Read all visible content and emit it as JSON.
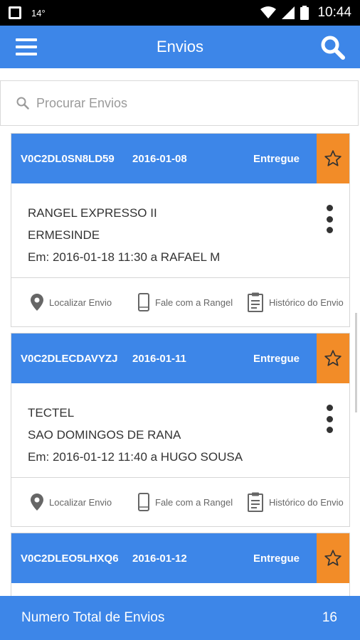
{
  "status_bar": {
    "temperature": "14°",
    "time": "10:44"
  },
  "app_bar": {
    "title": "Envios"
  },
  "search": {
    "placeholder": "Procurar Envios"
  },
  "shipments": [
    {
      "code": "V0C2DL0SN8LD59",
      "date": "2016-01-08",
      "status": "Entregue",
      "recipient": "RANGEL EXPRESSO II",
      "location": "ERMESINDE",
      "delivery": "Em: 2016-01-18 11:30 a RAFAEL M"
    },
    {
      "code": "V0C2DLECDAVYZJ",
      "date": "2016-01-11",
      "status": "Entregue",
      "recipient": "TECTEL",
      "location": "SAO DOMINGOS DE RANA",
      "delivery": "Em: 2016-01-12 11:40 a HUGO SOUSA"
    },
    {
      "code": "V0C2DLEO5LHXQ6",
      "date": "2016-01-12",
      "status": "Entregue"
    }
  ],
  "actions": {
    "locate": "Localizar Envio",
    "contact": "Fale com a Rangel",
    "history": "Histórico do Envio"
  },
  "footer": {
    "label": "Numero Total de Envios",
    "count": "16"
  },
  "colors": {
    "primary": "#3D86E8",
    "star_bg": "#F28C28",
    "status_bar": "#000000"
  }
}
